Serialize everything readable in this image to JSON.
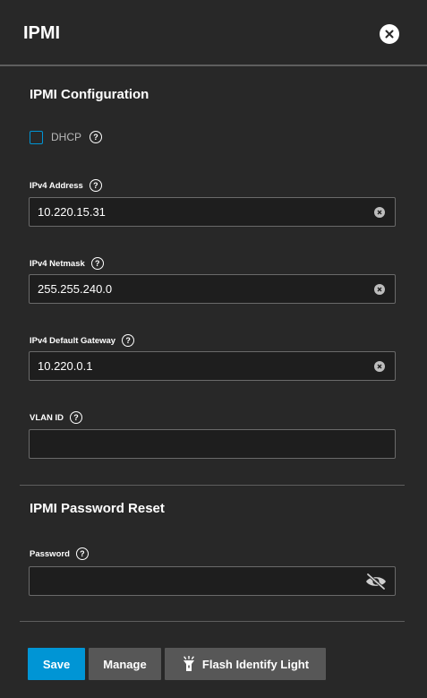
{
  "header": {
    "title": "IPMI"
  },
  "config": {
    "title": "IPMI Configuration",
    "dhcp_label": "DHCP",
    "dhcp_checked": false,
    "ipv4_address": {
      "label": "IPv4 Address",
      "value": "10.220.15.31"
    },
    "ipv4_netmask": {
      "label": "IPv4 Netmask",
      "value": "255.255.240.0"
    },
    "ipv4_gateway": {
      "label": "IPv4 Default Gateway",
      "value": "10.220.0.1"
    },
    "vlan_id": {
      "label": "VLAN ID",
      "value": ""
    }
  },
  "password_reset": {
    "title": "IPMI Password Reset",
    "password": {
      "label": "Password",
      "value": ""
    }
  },
  "actions": {
    "save_label": "Save",
    "manage_label": "Manage",
    "flash_label": "Flash Identify Light"
  },
  "colors": {
    "primary": "#0095d5",
    "background": "#282828",
    "button_secondary": "#575757"
  },
  "icons": [
    "close-icon",
    "help-icon",
    "clear-icon",
    "eye-off-icon",
    "flashlight-icon"
  ]
}
